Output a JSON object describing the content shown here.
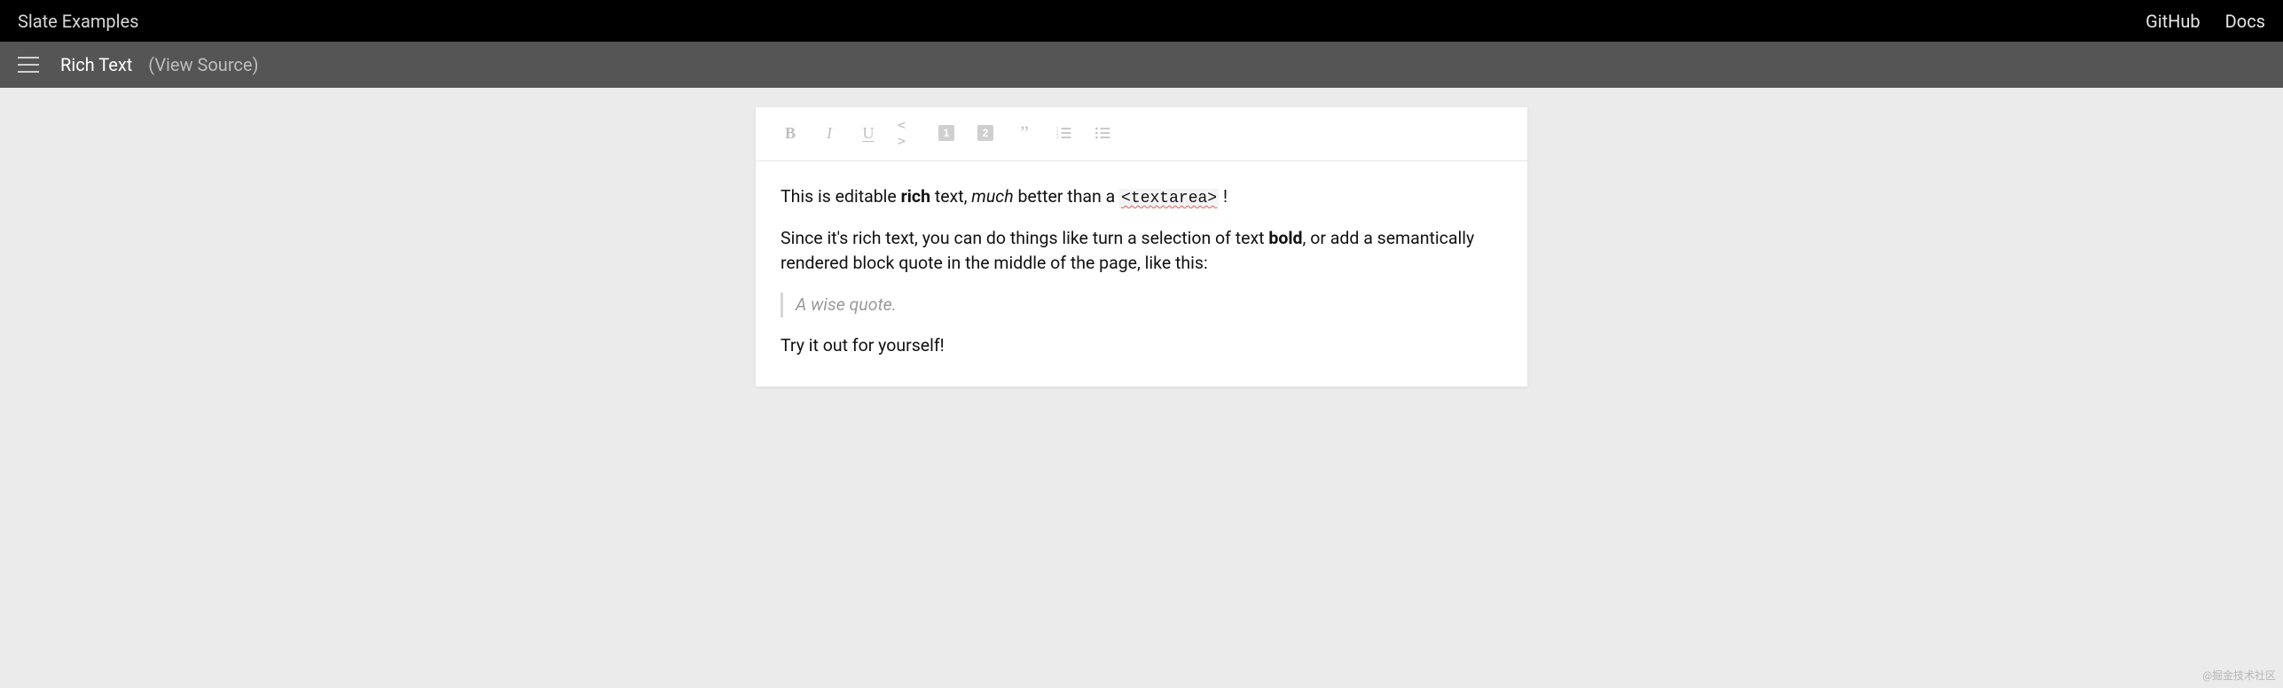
{
  "topnav": {
    "brand": "Slate Examples",
    "links": {
      "github": "GitHub",
      "docs": "Docs"
    }
  },
  "subnav": {
    "title": "Rich Text",
    "view_source": "(View Source)"
  },
  "toolbar": {
    "buttons": [
      {
        "name": "bold-icon",
        "label": "B"
      },
      {
        "name": "italic-icon",
        "label": "I"
      },
      {
        "name": "underline-icon",
        "label": "U"
      },
      {
        "name": "code-icon",
        "label": "< >"
      },
      {
        "name": "heading-one-icon",
        "label": "1"
      },
      {
        "name": "heading-two-icon",
        "label": "2"
      },
      {
        "name": "block-quote-icon",
        "label": "”"
      },
      {
        "name": "numbered-list-icon",
        "label": ""
      },
      {
        "name": "bulleted-list-icon",
        "label": ""
      }
    ]
  },
  "content": {
    "p1": {
      "t1": "This is editable ",
      "t2": "rich",
      "t3": " text, ",
      "t4": "much",
      "t5": " better than a ",
      "t6": "<textarea>",
      "t7": " !"
    },
    "p2": {
      "t1": "Since it's rich text, you can do things like turn a selection of text ",
      "t2": "bold",
      "t3": ", or add a semantically rendered block quote in the middle of the page, like this:"
    },
    "quote": "A wise quote.",
    "p3": "Try it out for yourself!"
  },
  "watermark": "@掘金技术社区"
}
